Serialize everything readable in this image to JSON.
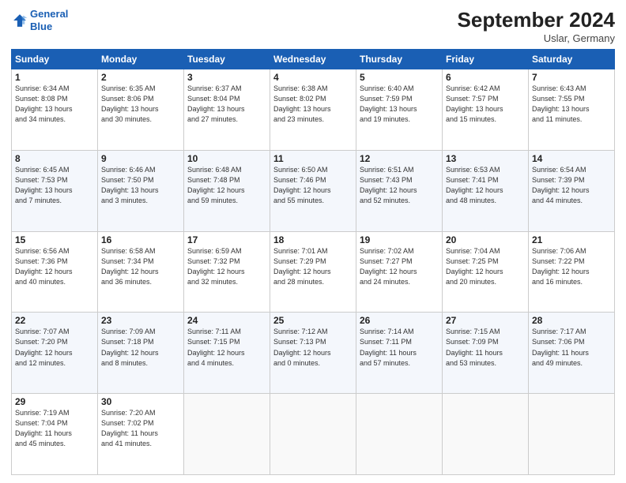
{
  "header": {
    "logo_line1": "General",
    "logo_line2": "Blue",
    "month": "September 2024",
    "location": "Uslar, Germany"
  },
  "weekdays": [
    "Sunday",
    "Monday",
    "Tuesday",
    "Wednesday",
    "Thursday",
    "Friday",
    "Saturday"
  ],
  "weeks": [
    [
      {
        "day": "1",
        "info": "Sunrise: 6:34 AM\nSunset: 8:08 PM\nDaylight: 13 hours\nand 34 minutes."
      },
      {
        "day": "2",
        "info": "Sunrise: 6:35 AM\nSunset: 8:06 PM\nDaylight: 13 hours\nand 30 minutes."
      },
      {
        "day": "3",
        "info": "Sunrise: 6:37 AM\nSunset: 8:04 PM\nDaylight: 13 hours\nand 27 minutes."
      },
      {
        "day": "4",
        "info": "Sunrise: 6:38 AM\nSunset: 8:02 PM\nDaylight: 13 hours\nand 23 minutes."
      },
      {
        "day": "5",
        "info": "Sunrise: 6:40 AM\nSunset: 7:59 PM\nDaylight: 13 hours\nand 19 minutes."
      },
      {
        "day": "6",
        "info": "Sunrise: 6:42 AM\nSunset: 7:57 PM\nDaylight: 13 hours\nand 15 minutes."
      },
      {
        "day": "7",
        "info": "Sunrise: 6:43 AM\nSunset: 7:55 PM\nDaylight: 13 hours\nand 11 minutes."
      }
    ],
    [
      {
        "day": "8",
        "info": "Sunrise: 6:45 AM\nSunset: 7:53 PM\nDaylight: 13 hours\nand 7 minutes."
      },
      {
        "day": "9",
        "info": "Sunrise: 6:46 AM\nSunset: 7:50 PM\nDaylight: 13 hours\nand 3 minutes."
      },
      {
        "day": "10",
        "info": "Sunrise: 6:48 AM\nSunset: 7:48 PM\nDaylight: 12 hours\nand 59 minutes."
      },
      {
        "day": "11",
        "info": "Sunrise: 6:50 AM\nSunset: 7:46 PM\nDaylight: 12 hours\nand 55 minutes."
      },
      {
        "day": "12",
        "info": "Sunrise: 6:51 AM\nSunset: 7:43 PM\nDaylight: 12 hours\nand 52 minutes."
      },
      {
        "day": "13",
        "info": "Sunrise: 6:53 AM\nSunset: 7:41 PM\nDaylight: 12 hours\nand 48 minutes."
      },
      {
        "day": "14",
        "info": "Sunrise: 6:54 AM\nSunset: 7:39 PM\nDaylight: 12 hours\nand 44 minutes."
      }
    ],
    [
      {
        "day": "15",
        "info": "Sunrise: 6:56 AM\nSunset: 7:36 PM\nDaylight: 12 hours\nand 40 minutes."
      },
      {
        "day": "16",
        "info": "Sunrise: 6:58 AM\nSunset: 7:34 PM\nDaylight: 12 hours\nand 36 minutes."
      },
      {
        "day": "17",
        "info": "Sunrise: 6:59 AM\nSunset: 7:32 PM\nDaylight: 12 hours\nand 32 minutes."
      },
      {
        "day": "18",
        "info": "Sunrise: 7:01 AM\nSunset: 7:29 PM\nDaylight: 12 hours\nand 28 minutes."
      },
      {
        "day": "19",
        "info": "Sunrise: 7:02 AM\nSunset: 7:27 PM\nDaylight: 12 hours\nand 24 minutes."
      },
      {
        "day": "20",
        "info": "Sunrise: 7:04 AM\nSunset: 7:25 PM\nDaylight: 12 hours\nand 20 minutes."
      },
      {
        "day": "21",
        "info": "Sunrise: 7:06 AM\nSunset: 7:22 PM\nDaylight: 12 hours\nand 16 minutes."
      }
    ],
    [
      {
        "day": "22",
        "info": "Sunrise: 7:07 AM\nSunset: 7:20 PM\nDaylight: 12 hours\nand 12 minutes."
      },
      {
        "day": "23",
        "info": "Sunrise: 7:09 AM\nSunset: 7:18 PM\nDaylight: 12 hours\nand 8 minutes."
      },
      {
        "day": "24",
        "info": "Sunrise: 7:11 AM\nSunset: 7:15 PM\nDaylight: 12 hours\nand 4 minutes."
      },
      {
        "day": "25",
        "info": "Sunrise: 7:12 AM\nSunset: 7:13 PM\nDaylight: 12 hours\nand 0 minutes."
      },
      {
        "day": "26",
        "info": "Sunrise: 7:14 AM\nSunset: 7:11 PM\nDaylight: 11 hours\nand 57 minutes."
      },
      {
        "day": "27",
        "info": "Sunrise: 7:15 AM\nSunset: 7:09 PM\nDaylight: 11 hours\nand 53 minutes."
      },
      {
        "day": "28",
        "info": "Sunrise: 7:17 AM\nSunset: 7:06 PM\nDaylight: 11 hours\nand 49 minutes."
      }
    ],
    [
      {
        "day": "29",
        "info": "Sunrise: 7:19 AM\nSunset: 7:04 PM\nDaylight: 11 hours\nand 45 minutes."
      },
      {
        "day": "30",
        "info": "Sunrise: 7:20 AM\nSunset: 7:02 PM\nDaylight: 11 hours\nand 41 minutes."
      },
      null,
      null,
      null,
      null,
      null
    ]
  ]
}
